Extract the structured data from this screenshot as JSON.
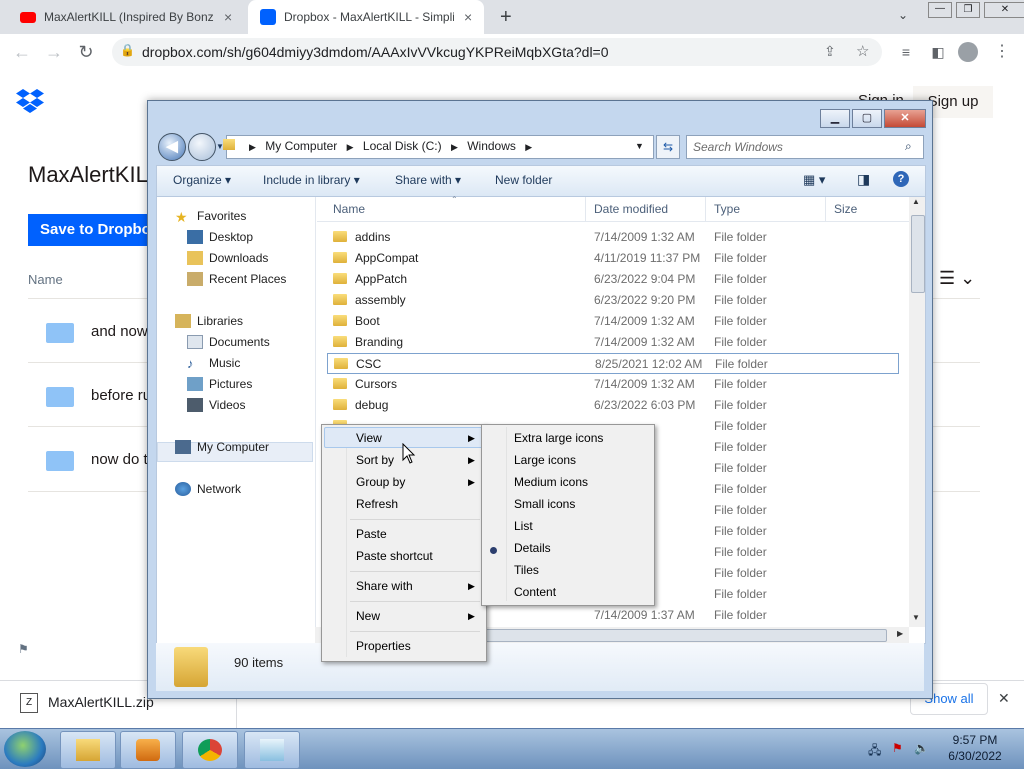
{
  "browser": {
    "tabs": [
      {
        "title": "MaxAlertKILL (Inspired By Bonzi",
        "close": "×",
        "active": false
      },
      {
        "title": "Dropbox - MaxAlertKILL - Simpli",
        "close": "×",
        "active": true
      }
    ],
    "new_tab": "+",
    "window_controls": {
      "minimize": "—",
      "restore": "❐",
      "close": "✕"
    },
    "url": "dropbox.com/sh/g604dmiyy3dmdom/AAAxIvVVkcugYKPReiMqbXGta?dl=0"
  },
  "dropbox": {
    "sign_in": "Sign in",
    "sign_up": "Sign up",
    "title": "MaxAlertKIL",
    "save_button": "Save to Dropbox",
    "column_name": "Name",
    "rows": [
      "and now",
      "before ru",
      "now do t"
    ]
  },
  "downloads": {
    "file": "MaxAlertKILL.zip",
    "show_all": "Show all",
    "close": "✕"
  },
  "explorer": {
    "breadcrumbs": [
      "My Computer",
      "Local Disk (C:)",
      "Windows"
    ],
    "search_placeholder": "Search Windows",
    "commands": {
      "organize": "Organize",
      "include": "Include in library",
      "share": "Share with",
      "new_folder": "New folder"
    },
    "nav": {
      "favorites": "Favorites",
      "favorites_items": [
        "Desktop",
        "Downloads",
        "Recent Places"
      ],
      "libraries": "Libraries",
      "libraries_items": [
        "Documents",
        "Music",
        "Pictures",
        "Videos"
      ],
      "computer": "My Computer",
      "network": "Network"
    },
    "columns": {
      "name": "Name",
      "date": "Date modified",
      "type": "Type",
      "size": "Size"
    },
    "files": [
      {
        "name": "addins",
        "date": "7/14/2009 1:32 AM",
        "type": "File folder"
      },
      {
        "name": "AppCompat",
        "date": "4/11/2019 11:37 PM",
        "type": "File folder"
      },
      {
        "name": "AppPatch",
        "date": "6/23/2022 9:04 PM",
        "type": "File folder"
      },
      {
        "name": "assembly",
        "date": "6/23/2022 9:20 PM",
        "type": "File folder"
      },
      {
        "name": "Boot",
        "date": "7/14/2009 1:32 AM",
        "type": "File folder"
      },
      {
        "name": "Branding",
        "date": "7/14/2009 1:32 AM",
        "type": "File folder"
      },
      {
        "name": "CSC",
        "date": "8/25/2021 12:02 AM",
        "type": "File folder"
      },
      {
        "name": "Cursors",
        "date": "7/14/2009 1:32 AM",
        "type": "File folder"
      },
      {
        "name": "debug",
        "date": "6/23/2022 6:03 PM",
        "type": "File folder"
      },
      {
        "name": "",
        "date": "",
        "type": "File folder"
      },
      {
        "name": "",
        "date": "",
        "type": "File folder"
      },
      {
        "name": "",
        "date": "",
        "type": "File folder"
      },
      {
        "name": "",
        "date": "",
        "type": "File folder"
      },
      {
        "name": "",
        "date": "",
        "type": "File folder"
      },
      {
        "name": "",
        "date": "",
        "type": "File folder"
      },
      {
        "name": "",
        "date": "",
        "type": "File folder"
      },
      {
        "name": "",
        "date": "",
        "type": "File folder"
      },
      {
        "name": "",
        "date": "",
        "type": "File folder"
      },
      {
        "name": "",
        "date": "7/14/2009 1:37 AM",
        "type": "File folder"
      }
    ],
    "item_count": "90 items"
  },
  "context_menu": {
    "view": "View",
    "sort_by": "Sort by",
    "group_by": "Group by",
    "refresh": "Refresh",
    "paste": "Paste",
    "paste_shortcut": "Paste shortcut",
    "share_with": "Share with",
    "new": "New",
    "properties": "Properties"
  },
  "view_submenu": [
    "Extra large icons",
    "Large icons",
    "Medium icons",
    "Small icons",
    "List",
    "Details",
    "Tiles",
    "Content"
  ],
  "taskbar": {
    "time": "9:57 PM",
    "date": "6/30/2022"
  },
  "colors": {
    "dropbox_blue": "#0061fe",
    "taskbar": "#8fadd3",
    "menu_bg": "#f0f0f0"
  }
}
